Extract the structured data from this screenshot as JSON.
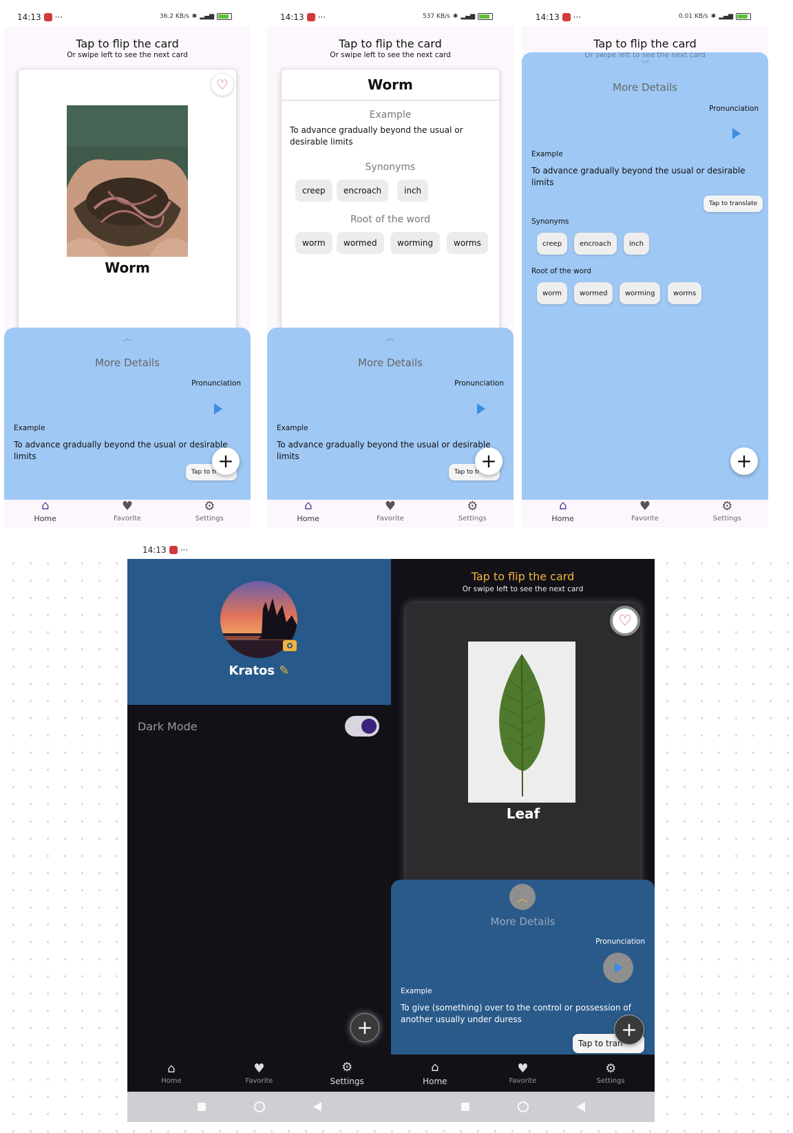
{
  "status": {
    "time": "14:13",
    "dots": "···",
    "battery_s1": "76",
    "speed_s1": "36.2 KB/s",
    "speed_s2": "537 KB/s",
    "speed_s3": "0.01 KB/s"
  },
  "header": {
    "title": "Tap to flip the card",
    "subtitle": "Or swipe left to see the next card"
  },
  "worm": {
    "word": "Worm",
    "example_title": "Example",
    "example_text": "To advance gradually beyond the usual or desirable limits",
    "synonyms_title": "Synonyms",
    "synonyms": [
      "creep",
      "encroach",
      "inch"
    ],
    "root_title": "Root of the word",
    "roots": [
      "worm",
      "wormed",
      "worming",
      "worms"
    ]
  },
  "details": {
    "title": "More Details",
    "pronunciation_label": "Pronunciation",
    "example_label": "Example",
    "synonyms_label": "Synonyms",
    "root_label": "Root of the word",
    "translate_label": "Tap to translate",
    "translate_truncated": "Tap to tr",
    "translate_truncated_dark": "Tap to tran"
  },
  "nav": {
    "home": "Home",
    "favorite": "Favorite",
    "settings": "Settings"
  },
  "settings_screen": {
    "username": "Kratos",
    "dark_mode_label": "Dark Mode",
    "dark_mode_on": true
  },
  "leaf": {
    "word": "Leaf",
    "example_text": "To give (something) over to the control or possession of another usually under duress"
  },
  "colors": {
    "details_blue": "#9fc8f4",
    "dark_details_blue": "#2a5a8a",
    "header_blue": "#27598a",
    "accent_purple": "#5a3f93",
    "dark_title_yellow": "#f2b33d",
    "heart_pink": "#e8457d"
  },
  "icons": [
    "home-icon",
    "heart-icon",
    "gear-icon",
    "play-icon",
    "plus-icon",
    "camera-icon",
    "pencil-icon",
    "chevron-up-icon",
    "chevron-down-icon"
  ]
}
